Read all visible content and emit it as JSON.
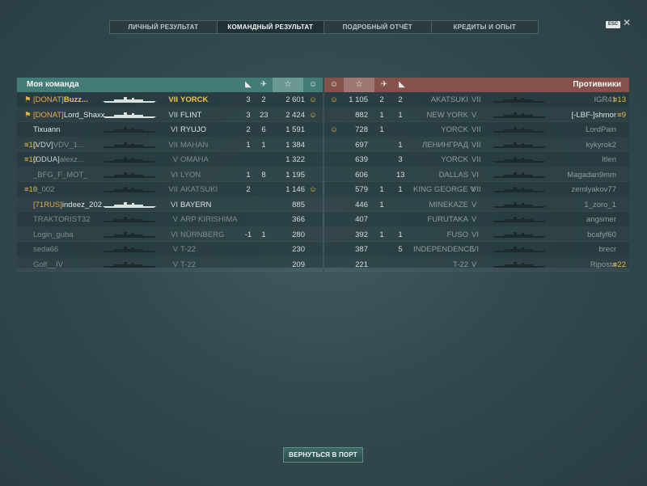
{
  "tabs": [
    {
      "label": "ЛИЧНЫЙ РЕЗУЛЬТАТ",
      "active": false
    },
    {
      "label": "КОМАНДНЫЙ РЕЗУЛЬТАТ",
      "active": true
    },
    {
      "label": "ПОДРОБНЫЙ ОТЧЁТ",
      "active": false
    },
    {
      "label": "КРЕДИТЫ И ОПЫТ",
      "active": false
    }
  ],
  "esc_label": "ESC",
  "my_team": {
    "title": "Моя команда",
    "players": [
      {
        "badge": "⚑",
        "clan": "[DONAT]",
        "name": "Buzz...",
        "rank": "⁂1",
        "tier": "VII",
        "ship": "YORCK",
        "kills": "3",
        "planes": "2",
        "xp": "2 601",
        "medal": "☺",
        "highlight": true,
        "dim": false
      },
      {
        "badge": "⚑",
        "clan": "[DONAT]",
        "name": "Lord_Shaxx",
        "rank": "",
        "tier": "VII",
        "ship": "FLINT",
        "kills": "3",
        "planes": "23",
        "xp": "2 424",
        "medal": "☺",
        "highlight": false,
        "dim": false
      },
      {
        "badge": "",
        "clan": "",
        "name": "Tixuann",
        "rank": "",
        "tier": "VI",
        "ship": "RYUJO",
        "kills": "2",
        "planes": "6",
        "xp": "1 591",
        "medal": "",
        "highlight": false,
        "dim": false
      },
      {
        "badge": "≡10",
        "clan": "[VDV]",
        "name": "VDV_1...",
        "rank": "",
        "tier": "VII",
        "ship": "MAHAN",
        "kills": "1",
        "planes": "1",
        "xp": "1 384",
        "medal": "",
        "highlight": false,
        "dim": true
      },
      {
        "badge": "≡10",
        "clan": "[ODUA]",
        "name": "alexz...",
        "rank": "",
        "tier": "V",
        "ship": "OMAHA",
        "kills": "",
        "planes": "",
        "xp": "1 322",
        "medal": "",
        "highlight": false,
        "dim": true
      },
      {
        "badge": "",
        "clan": "",
        "name": "_BFG_F_MOT_",
        "rank": "",
        "tier": "VI",
        "ship": "LYON",
        "kills": "1",
        "planes": "8",
        "xp": "1 195",
        "medal": "",
        "highlight": false,
        "dim": true
      },
      {
        "badge": "≡10",
        "clan": "",
        "name": "a_002",
        "rank": "",
        "tier": "VII",
        "ship": "AKATSUKI",
        "kills": "2",
        "planes": "",
        "xp": "1 146",
        "medal": "☺",
        "highlight": false,
        "dim": true
      },
      {
        "badge": "",
        "clan": "[71RUS]",
        "name": "indeez_202",
        "rank": "",
        "tier": "VI",
        "ship": "BAYERN",
        "kills": "",
        "planes": "",
        "xp": "885",
        "medal": "",
        "highlight": false,
        "dim": false
      },
      {
        "badge": "",
        "clan": "",
        "name": "TRAKTORIST32",
        "rank": "",
        "tier": "V",
        "ship": "ARP KIRISHIMA",
        "kills": "",
        "planes": "",
        "xp": "366",
        "medal": "",
        "highlight": false,
        "dim": true
      },
      {
        "badge": "",
        "clan": "",
        "name": "Login_guba",
        "rank": "",
        "tier": "VI",
        "ship": "NÜRNBERG",
        "kills": "-1",
        "planes": "1",
        "xp": "280",
        "medal": "",
        "highlight": false,
        "dim": true
      },
      {
        "badge": "",
        "clan": "",
        "name": "seda66",
        "rank": "",
        "tier": "V",
        "ship": "T-22",
        "kills": "",
        "planes": "",
        "xp": "230",
        "medal": "",
        "highlight": false,
        "dim": true
      },
      {
        "badge": "",
        "clan": "",
        "name": "Golf__IV",
        "rank": "",
        "tier": "V",
        "ship": "T-22",
        "kills": "",
        "planes": "",
        "xp": "209",
        "medal": "",
        "highlight": false,
        "dim": true
      }
    ]
  },
  "enemy_team": {
    "title": "Противники",
    "players": [
      {
        "medal": "☺",
        "xp": "1 105",
        "kills": "2",
        "planes": "2",
        "ship": "AKATSUKI",
        "tier": "VII",
        "name": "IGR41",
        "badge": "≡13",
        "alive": false
      },
      {
        "medal": "",
        "xp": "882",
        "kills": "1",
        "planes": "1",
        "ship": "NEW YORK",
        "tier": "V",
        "name": "[-LBF-]shmor",
        "badge": "≡9",
        "alive": true
      },
      {
        "medal": "☺",
        "xp": "728",
        "kills": "",
        "planes": "1",
        "ship": "YORCK",
        "tier": "VII",
        "name": "LordPain",
        "badge": "",
        "alive": false
      },
      {
        "medal": "",
        "xp": "697",
        "kills": "1",
        "planes": "",
        "ship": "ЛЕНИНГРАД",
        "tier": "VII",
        "name": "kykyrok2",
        "badge": "",
        "alive": false
      },
      {
        "medal": "",
        "xp": "639",
        "kills": "3",
        "planes": "",
        "ship": "YORCK",
        "tier": "VII",
        "name": "Itlen",
        "badge": "",
        "alive": false
      },
      {
        "medal": "",
        "xp": "606",
        "kills": "13",
        "planes": "",
        "ship": "DALLAS",
        "tier": "VI",
        "name": "Magadan9mm",
        "badge": "",
        "alive": false
      },
      {
        "medal": "",
        "xp": "579",
        "kills": "1",
        "planes": "1",
        "ship": "KING GEORGE V",
        "tier": "VII",
        "name": "zemlyakov77",
        "badge": "",
        "alive": false
      },
      {
        "medal": "",
        "xp": "446",
        "kills": "",
        "planes": "1",
        "ship": "MINEKAZE",
        "tier": "V",
        "name": "1_zoro_1",
        "badge": "",
        "alive": false
      },
      {
        "medal": "",
        "xp": "407",
        "kills": "",
        "planes": "",
        "ship": "FURUTAKA",
        "tier": "V",
        "name": "angsmer",
        "badge": "",
        "alive": false
      },
      {
        "medal": "",
        "xp": "392",
        "kills": "1",
        "planes": "1",
        "ship": "FUSO",
        "tier": "VI",
        "name": "bcafyf60",
        "badge": "",
        "alive": false
      },
      {
        "medal": "",
        "xp": "387",
        "kills": "5",
        "planes": "",
        "ship": "INDEPENDENCE",
        "tier": "VI",
        "name": "brecr",
        "badge": "",
        "alive": false
      },
      {
        "medal": "",
        "xp": "221",
        "kills": "",
        "planes": "",
        "ship": "T-22",
        "tier": "V",
        "name": "Riposta",
        "badge": "≡22",
        "alive": false
      }
    ]
  },
  "column_icons": {
    "kills": "ship-kill-icon",
    "planes": "plane-kill-icon",
    "xp": "star-icon",
    "medal": "laurel-icon"
  },
  "glyphs": {
    "kills": "◣",
    "planes": "✈",
    "xp": "☆",
    "medal": "☺"
  },
  "return_button": "ВЕРНУТЬСЯ В ПОРТ",
  "colors": {
    "team_header": "#437c77",
    "enemy_header": "#84524b",
    "highlight": "#f0c54a",
    "clan_orange": "#e8a94a"
  }
}
